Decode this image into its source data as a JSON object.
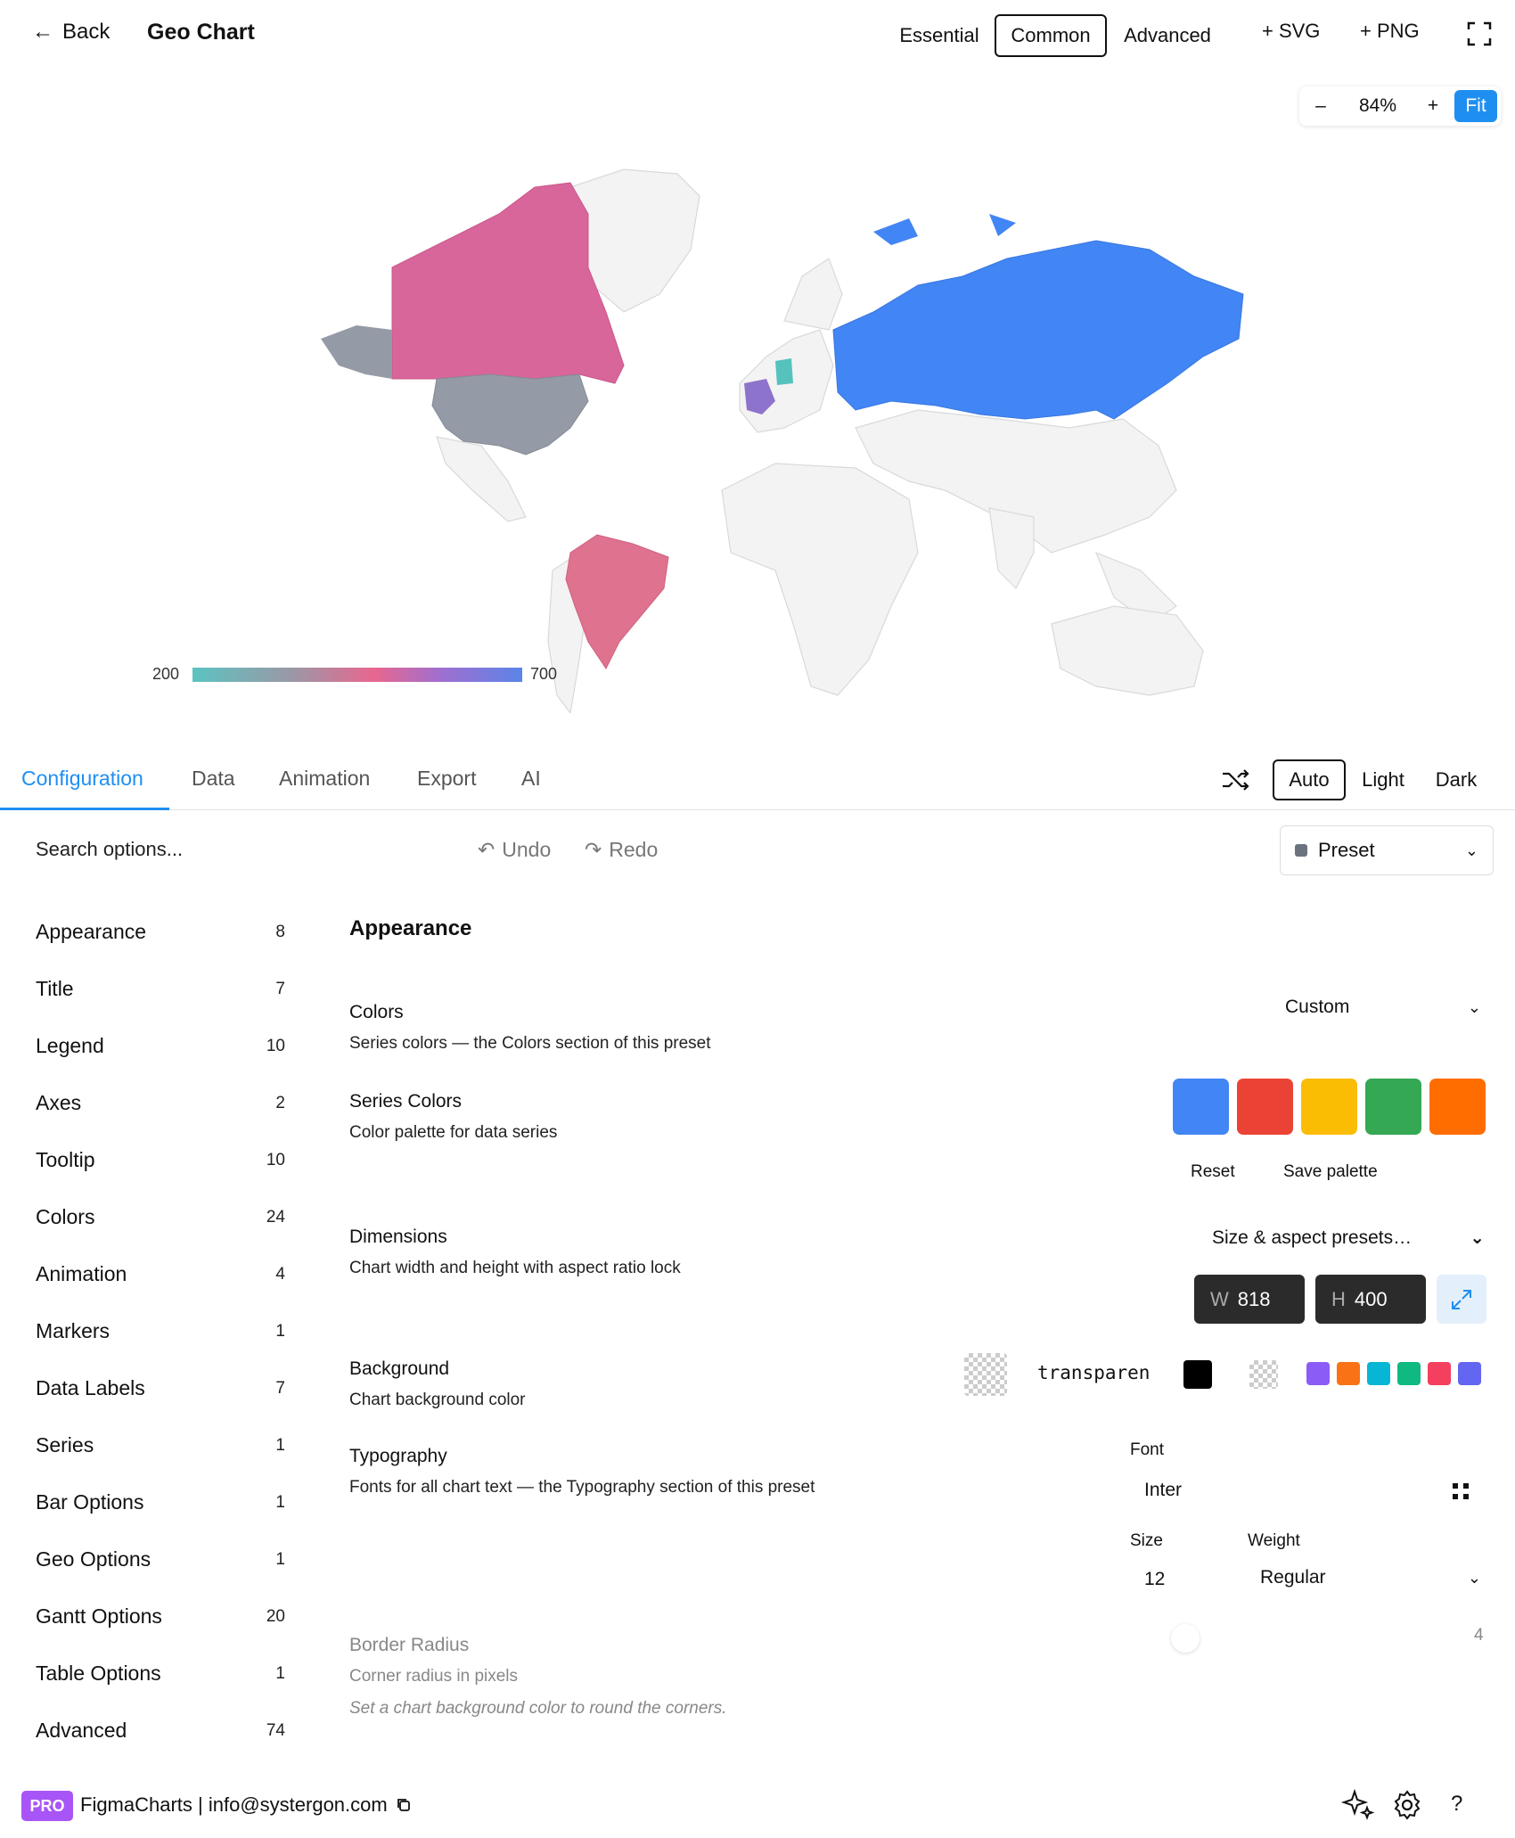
{
  "header": {
    "back_label": "Back",
    "title": "Geo Chart",
    "mode_tabs": [
      "Essential",
      "Common",
      "Advanced"
    ],
    "active_mode": "Common",
    "svg_label": "+ SVG",
    "png_label": "+ PNG"
  },
  "zoom": {
    "minus": "–",
    "value": "84%",
    "plus": "+",
    "fit": "Fit"
  },
  "chart_data": {
    "type": "geo",
    "title": "",
    "color_scale": {
      "min": 200,
      "max": 700,
      "min_label": "200",
      "max_label": "700"
    },
    "regions": [
      {
        "name": "Russia",
        "color": "#4285f4"
      },
      {
        "name": "Canada",
        "color": "#d9669a"
      },
      {
        "name": "United States",
        "color": "#959ba6"
      },
      {
        "name": "Brazil",
        "color": "#de728f"
      },
      {
        "name": "France",
        "color": "#8e73cc"
      },
      {
        "name": "Germany",
        "color": "#56c2be"
      }
    ]
  },
  "tabs": {
    "items": [
      "Configuration",
      "Data",
      "Animation",
      "Export",
      "AI"
    ],
    "active": "Configuration",
    "themes": [
      "Auto",
      "Light",
      "Dark"
    ],
    "active_theme": "Auto"
  },
  "toolbar": {
    "search_placeholder": "Search options...",
    "undo": "Undo",
    "redo": "Redo",
    "preset": "Preset"
  },
  "sidebar": {
    "items": [
      {
        "label": "Appearance",
        "count": "8"
      },
      {
        "label": "Title",
        "count": "7"
      },
      {
        "label": "Legend",
        "count": "10"
      },
      {
        "label": "Axes",
        "count": "2"
      },
      {
        "label": "Tooltip",
        "count": "10"
      },
      {
        "label": "Colors",
        "count": "24"
      },
      {
        "label": "Animation",
        "count": "4"
      },
      {
        "label": "Markers",
        "count": "1"
      },
      {
        "label": "Data Labels",
        "count": "7"
      },
      {
        "label": "Series",
        "count": "1"
      },
      {
        "label": "Bar Options",
        "count": "1"
      },
      {
        "label": "Geo Options",
        "count": "1"
      },
      {
        "label": "Gantt Options",
        "count": "20"
      },
      {
        "label": "Table Options",
        "count": "1"
      },
      {
        "label": "Advanced",
        "count": "74"
      }
    ]
  },
  "panel": {
    "section_title": "Appearance",
    "colors": {
      "title": "Colors",
      "desc": "Series colors — the Colors section of this preset",
      "value": "Custom"
    },
    "series_colors": {
      "title": "Series Colors",
      "desc": "Color palette for data series",
      "swatches": [
        "#4285f4",
        "#ea4335",
        "#fbbc04",
        "#34a853",
        "#ff6d01"
      ],
      "reset": "Reset",
      "save": "Save palette"
    },
    "dimensions": {
      "title": "Dimensions",
      "desc": "Chart width and height with aspect ratio lock",
      "presets": "Size & aspect presets…",
      "w_label": "W",
      "w_value": "818",
      "h_label": "H",
      "h_value": "400"
    },
    "background": {
      "title": "Background",
      "desc": "Chart background color",
      "value": "transparen",
      "quick_colors": [
        "#8b5cf6",
        "#f97316",
        "#06b6d4",
        "#10b981",
        "#f43f5e",
        "#6366f1"
      ]
    },
    "typography": {
      "title": "Typography",
      "desc": "Fonts for all chart text — the Typography section of this preset",
      "font_label": "Font",
      "font_value": "Inter",
      "size_label": "Size",
      "size_value": "12",
      "weight_label": "Weight",
      "weight_value": "Regular"
    },
    "border_radius": {
      "title": "Border Radius",
      "desc": "Corner radius in pixels",
      "note": "Set a chart background color to round the corners.",
      "value": "4"
    }
  },
  "footer": {
    "badge": "PRO",
    "text": "FigmaCharts | info@systergon.com",
    "help": "?"
  }
}
